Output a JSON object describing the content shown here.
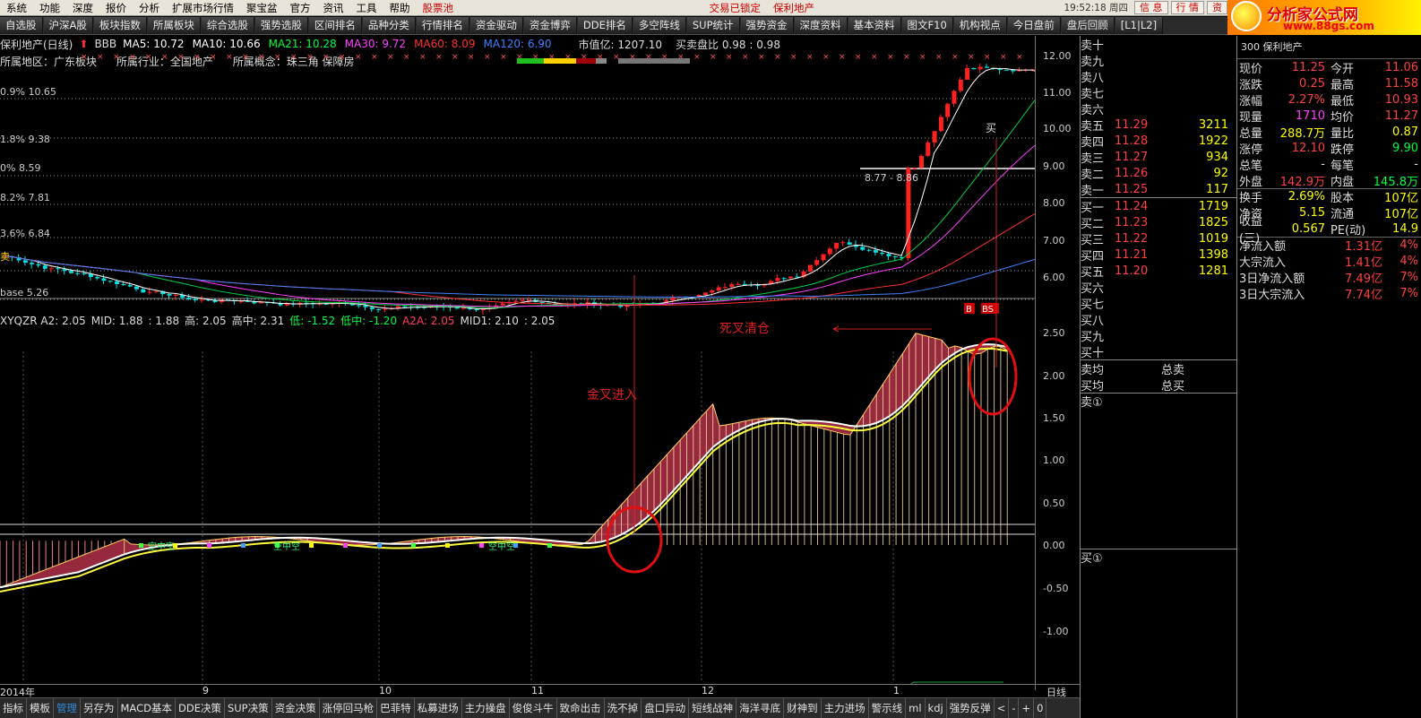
{
  "menu": [
    "系统",
    "功能",
    "深度",
    "报价",
    "分析",
    "扩展市场行情",
    "聚宝盆",
    "官方",
    "资讯",
    "工具",
    "帮助"
  ],
  "menu_red": "股票池",
  "menu_notices": [
    "交易已锁定",
    "保利地产"
  ],
  "clock": "19:52:18 周四",
  "menu_buttons": [
    "信 息",
    "行 情",
    "资"
  ],
  "toolbar": [
    "自选股",
    "沪深A股",
    "板块指数",
    "所属板块",
    "综合选股",
    "强势选股",
    "区间排名",
    "品种分类",
    "行情排名",
    "资金驱动",
    "资金博弈",
    "DDE排名",
    "多空阵线",
    "SUP统计",
    "强势资金",
    "深度资料",
    "基本资料",
    "图文F10",
    "机构视点",
    "今日盘前",
    "盘后回顾",
    "[L1|L2]"
  ],
  "ad": {
    "title": "分析家公式网",
    "url": "www.88gs.com"
  },
  "chart_info": {
    "title": "保利地产(日线)",
    "bbb": "BBB",
    "ma": [
      {
        "label": "MA5: 10.72",
        "color": "#ffffff"
      },
      {
        "label": "MA10: 10.66",
        "color": "#ffffff"
      },
      {
        "label": "MA21: 10.28",
        "color": "#00ff40"
      },
      {
        "label": "MA30: 9.72",
        "color": "#ff40ff"
      },
      {
        "label": "MA60: 8.09",
        "color": "#ff3030"
      },
      {
        "label": "MA120: 6.90",
        "color": "#4080ff"
      }
    ],
    "cap": "市值亿: 1207.10",
    "ratio": "买卖盘比  0.98 : 0.98"
  },
  "region": [
    "所属地区：广东板块",
    "所属行业：全国地产",
    "所属概念：珠三角 保障房"
  ],
  "left_pct": [
    "0.9% 10.65",
    "1.8% 9.38",
    "0% 8.59",
    "8.2% 7.81",
    "3.6% 6.84",
    "base 5.26"
  ],
  "price_labels": [
    "8.77 - 8.86",
    "买",
    "B",
    "BS",
    "卖"
  ],
  "indicator_info": [
    {
      "t": "XYQZR A2: 2.05",
      "c": "#ddd"
    },
    {
      "t": "MID: 1.88",
      "c": "#ddd"
    },
    {
      "t": ": 1.88",
      "c": "#ddd"
    },
    {
      "t": "高: 2.05",
      "c": "#ddd"
    },
    {
      "t": "高中: 2.31",
      "c": "#ddd"
    },
    {
      "t": "低: -1.52",
      "c": "#00ff40"
    },
    {
      "t": "低中: -1.20",
      "c": "#00ff40"
    },
    {
      "t": "A2A: 2.05",
      "c": "#ff4060"
    },
    {
      "t": "MID1: 2.10",
      "c": "#ddd"
    },
    {
      "t": ": 2.05",
      "c": "#ddd"
    }
  ],
  "annotations": {
    "golden": "金叉进入",
    "death": "死叉清仓",
    "signal": "空中空"
  },
  "price_axis": [
    "12.00",
    "11.00",
    "10.00",
    "9.00",
    "8.00",
    "7.00",
    "6.00"
  ],
  "ind_axis": [
    "2.50",
    "2.00",
    "1.50",
    "1.00",
    "0.50",
    "0.00",
    "-0.50",
    "-1.00"
  ],
  "x_axis": [
    "2014年",
    "9",
    "10",
    "11",
    "12",
    "1"
  ],
  "period": "日线",
  "bottom_tabs": [
    "指标",
    "模板",
    "管理",
    "另存为",
    "MACD基本",
    "DDE决策",
    "SUP决策",
    "资金决策",
    "涨停回马枪",
    "巴菲特",
    "私募进场",
    "主力操盘",
    "俊俊斗牛",
    "致命出击",
    "洗不掉",
    "盘口异动",
    "短线战神",
    "海洋寻底",
    "财神到",
    "主力进场",
    "警示线",
    "ml",
    "kdj",
    "强势反弹",
    "<",
    "-",
    "+",
    "0"
  ],
  "orderbook": {
    "sells": [
      {
        "l": "卖十",
        "p": "",
        "v": ""
      },
      {
        "l": "卖九",
        "p": "",
        "v": ""
      },
      {
        "l": "卖八",
        "p": "",
        "v": ""
      },
      {
        "l": "卖七",
        "p": "",
        "v": ""
      },
      {
        "l": "卖六",
        "p": "",
        "v": ""
      },
      {
        "l": "卖五",
        "p": "11.29",
        "v": "3211"
      },
      {
        "l": "卖四",
        "p": "11.28",
        "v": "1922"
      },
      {
        "l": "卖三",
        "p": "11.27",
        "v": "934"
      },
      {
        "l": "卖二",
        "p": "11.26",
        "v": "92"
      },
      {
        "l": "卖一",
        "p": "11.25",
        "v": "117"
      }
    ],
    "buys": [
      {
        "l": "买一",
        "p": "11.24",
        "v": "1719"
      },
      {
        "l": "买二",
        "p": "11.23",
        "v": "1825"
      },
      {
        "l": "买三",
        "p": "11.22",
        "v": "1019"
      },
      {
        "l": "买四",
        "p": "11.21",
        "v": "1398"
      },
      {
        "l": "买五",
        "p": "11.20",
        "v": "1281"
      },
      {
        "l": "买六",
        "p": "",
        "v": ""
      },
      {
        "l": "买七",
        "p": "",
        "v": ""
      },
      {
        "l": "买八",
        "p": "",
        "v": ""
      },
      {
        "l": "买九",
        "p": "",
        "v": ""
      },
      {
        "l": "买十",
        "p": "",
        "v": ""
      }
    ],
    "avg": [
      {
        "l": "卖均",
        "r": "总卖"
      },
      {
        "l": "买均",
        "r": "总买"
      }
    ],
    "sell1": "卖①",
    "buy1": "买①"
  },
  "quote": {
    "header": "300 保利地产",
    "rows": [
      {
        "k": "现价",
        "v": "11.25",
        "vc": "#ff4040",
        "k2": "今开",
        "v2": "11.06",
        "v2c": "#ff4040"
      },
      {
        "k": "涨跌",
        "v": "0.25",
        "vc": "#ff4040",
        "k2": "最高",
        "v2": "11.58",
        "v2c": "#ff4040"
      },
      {
        "k": "涨幅",
        "v": "2.27%",
        "vc": "#ff4040",
        "k2": "最低",
        "v2": "10.93",
        "v2c": "#ff4040"
      },
      {
        "k": "现量",
        "v": "1710",
        "vc": "#ff40ff",
        "k2": "均价",
        "v2": "11.27",
        "v2c": "#ff4040"
      },
      {
        "k": "总量",
        "v": "288.7万",
        "vc": "#ffff00",
        "k2": "量比",
        "v2": "0.87",
        "v2c": "#ffff00"
      },
      {
        "k": "涨停",
        "v": "12.10",
        "vc": "#ff4040",
        "k2": "跌停",
        "v2": "9.90",
        "v2c": "#00ff40"
      },
      {
        "k": "总笔",
        "v": "-",
        "vc": "#ddd",
        "k2": "每笔",
        "v2": "-",
        "v2c": "#ddd"
      },
      {
        "k": "外盘",
        "v": "142.9万",
        "vc": "#ff4040",
        "k2": "内盘",
        "v2": "145.8万",
        "v2c": "#00ff40"
      },
      {
        "k": "换手",
        "v": "2.69%",
        "vc": "#ffff00",
        "k2": "股本",
        "v2": "107亿",
        "v2c": "#ffff00"
      },
      {
        "k": "净资",
        "v": "5.15",
        "vc": "#ffff00",
        "k2": "流通",
        "v2": "107亿",
        "v2c": "#ffff00"
      },
      {
        "k": "收益(三)",
        "v": "0.567",
        "vc": "#ffff00",
        "k2": "PE(动)",
        "v2": "14.9",
        "v2c": "#ffff00"
      }
    ],
    "flows": [
      {
        "k": "净流入额",
        "v": "1.31亿",
        "p": "4%"
      },
      {
        "k": "大宗流入",
        "v": "1.41亿",
        "p": "4%"
      },
      {
        "k": "3日净流入额",
        "v": "7.49亿",
        "p": "7%"
      },
      {
        "k": "3日大宗流入",
        "v": "7.74亿",
        "p": "7%"
      }
    ]
  }
}
